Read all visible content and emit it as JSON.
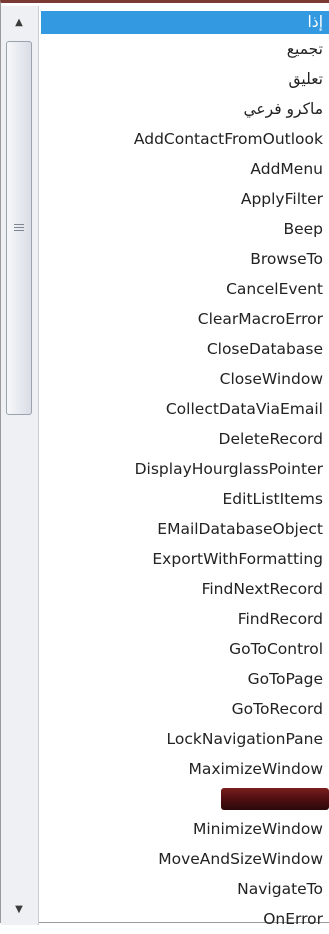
{
  "scrollbar": {
    "up_glyph": "▲",
    "down_glyph": "▼"
  },
  "list": {
    "items": [
      "إذا",
      "تجميع",
      "تعليق",
      "ماكرو فرعي",
      "AddContactFromOutlook",
      "AddMenu",
      "ApplyFilter",
      "Beep",
      "BrowseTo",
      "CancelEvent",
      "ClearMacroError",
      "CloseDatabase",
      "CloseWindow",
      "CollectDataViaEmail",
      "DeleteRecord",
      "DisplayHourglassPointer",
      "EditListItems",
      "EMailDatabaseObject",
      "ExportWithFormatting",
      "FindNextRecord",
      "FindRecord",
      "GoToControl",
      "GoToPage",
      "GoToRecord",
      "LockNavigationPane",
      "MaximizeWindow",
      "",
      "MinimizeWindow",
      "MoveAndSizeWindow",
      "NavigateTo",
      "OnError"
    ],
    "selected_index": 0
  },
  "colors": {
    "selection": "#3399e0",
    "top_border": "#7a3a33",
    "highlight_band": "#4b0d10"
  }
}
